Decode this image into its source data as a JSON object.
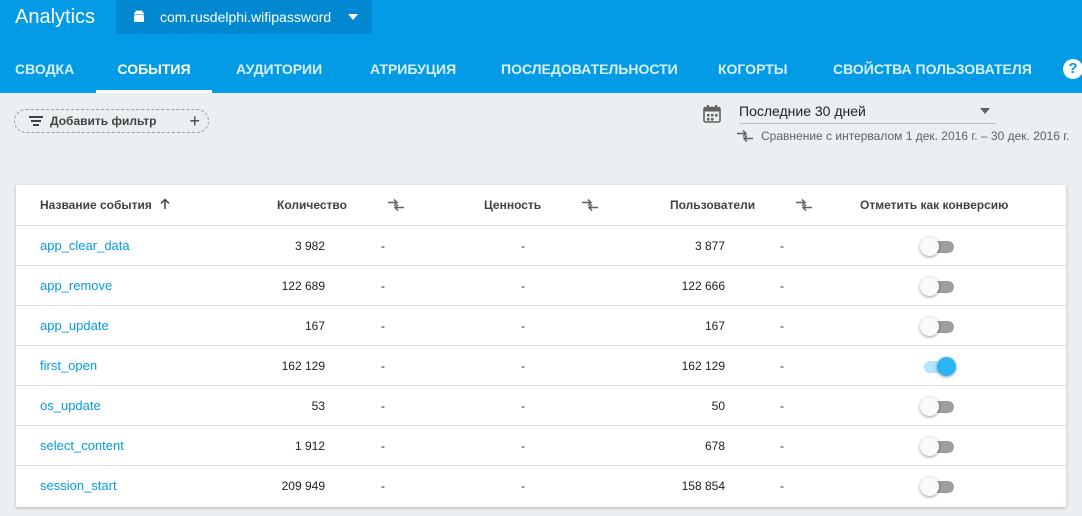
{
  "header": {
    "title": "Analytics",
    "app_name": "com.rusdelphi.wifipassword",
    "tabs": [
      {
        "label": "СВОДКА"
      },
      {
        "label": "СОБЫТИЯ"
      },
      {
        "label": "АУДИТОРИИ"
      },
      {
        "label": "АТРИБУЦИЯ"
      },
      {
        "label": "ПОСЛЕДОВАТЕЛЬНОСТИ"
      },
      {
        "label": "КОГОРТЫ"
      },
      {
        "label": "СВОЙСТВА ПОЛЬЗОВАТЕЛЯ"
      }
    ],
    "active_tab": "СОБЫТИЯ",
    "help_label": "?"
  },
  "filter": {
    "label": "Добавить фильтр"
  },
  "date": {
    "range": "Последние 30 дней",
    "comparison": "Сравнение с интервалом 1 дек. 2016 г. – 30 дек. 2016 г."
  },
  "table": {
    "columns": {
      "name": "Название события",
      "count": "Количество",
      "value": "Ценность",
      "users": "Пользователи",
      "conversion": "Отметить как конверсию"
    },
    "rows": [
      {
        "name": "app_clear_data",
        "count": "3 982",
        "count_cmp": "-",
        "value": "-",
        "users": "3 877",
        "users_cmp": "-",
        "conversion": false
      },
      {
        "name": "app_remove",
        "count": "122 689",
        "count_cmp": "-",
        "value": "-",
        "users": "122 666",
        "users_cmp": "-",
        "conversion": false
      },
      {
        "name": "app_update",
        "count": "167",
        "count_cmp": "-",
        "value": "-",
        "users": "167",
        "users_cmp": "-",
        "conversion": false
      },
      {
        "name": "first_open",
        "count": "162 129",
        "count_cmp": "-",
        "value": "-",
        "users": "162 129",
        "users_cmp": "-",
        "conversion": true
      },
      {
        "name": "os_update",
        "count": "53",
        "count_cmp": "-",
        "value": "-",
        "users": "50",
        "users_cmp": "-",
        "conversion": false
      },
      {
        "name": "select_content",
        "count": "1 912",
        "count_cmp": "-",
        "value": "-",
        "users": "678",
        "users_cmp": "-",
        "conversion": false
      },
      {
        "name": "session_start",
        "count": "209 949",
        "count_cmp": "-",
        "value": "-",
        "users": "158 854",
        "users_cmp": "-",
        "conversion": false
      }
    ]
  },
  "colors": {
    "primary": "#039be5",
    "app_selector": "#0288d1",
    "toggle_on": "#29b6f6"
  }
}
